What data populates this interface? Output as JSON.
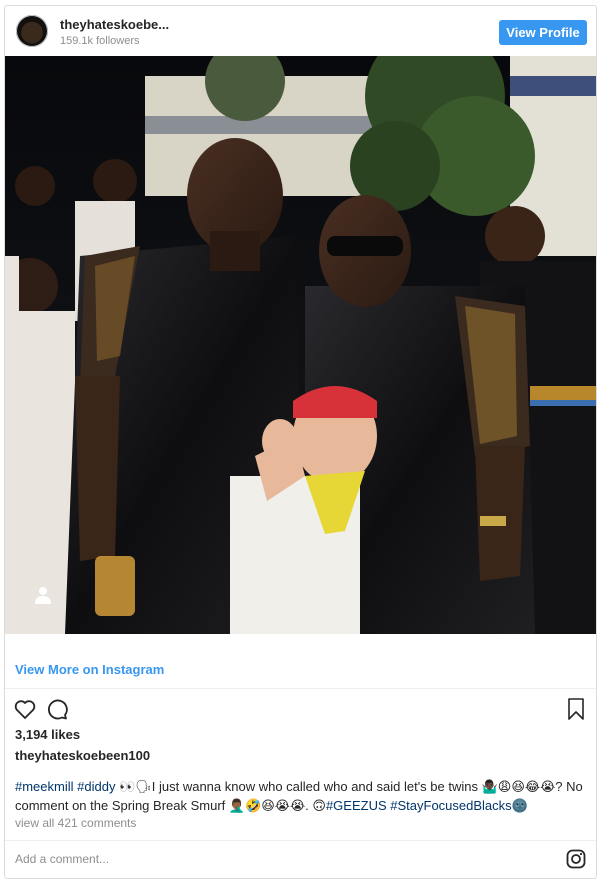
{
  "header": {
    "username": "theyhateskoebe...",
    "followers": "159.1k followers",
    "view_profile_label": "View Profile"
  },
  "photo": {
    "user_tag_icon": "user-icon"
  },
  "view_more_label": "View More on Instagram",
  "actions": {
    "like_icon": "heart-icon",
    "comment_icon": "comment-icon",
    "save_icon": "bookmark-icon"
  },
  "likes": "3,194 likes",
  "post_owner": "theyhateskoebeen100",
  "caption": {
    "tag1": "#meekmill",
    "tag2": "#diddy",
    "text1": " 👀🗣I just wanna know who called who and said let's be twins 🤷🏿‍♂️😩😆😂😭? No comment on the Spring Break Smurf 🤦🏾‍♂️🤣😆😭😭. 🙃",
    "tag3": "#GEEZUS",
    "tag4": "#StayFocusedBlacks",
    "text2": "🌚"
  },
  "view_comments": "view all 421 comments",
  "add_comment_placeholder": "Add a comment...",
  "colors": {
    "accent": "#3897f0",
    "hashtag": "#003569",
    "muted": "#8e8e8e"
  }
}
